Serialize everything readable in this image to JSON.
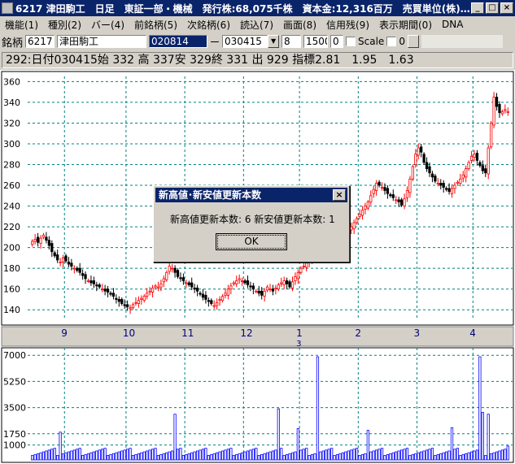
{
  "window": {
    "title": "6217 津田駒工　日足　東証一部・機械　発行株:68,075千株　資本金:12,316百万　売買単位(株)…"
  },
  "menu": [
    "機能(1)",
    "種別(2)",
    "バー(4)",
    "前銘柄(5)",
    "次銘柄(6)",
    "読込(7)",
    "画面(8)",
    "信用残(9)",
    "表示期間(0)",
    "DNA"
  ],
  "toolbar": {
    "label": "銘柄",
    "code": "6217",
    "name": "津田駒工",
    "date_from": "020814",
    "separator": "ー",
    "date_to": "030415",
    "n1": "8",
    "n2": "1500",
    "n3": "0",
    "scale_label": "Scale",
    "n4": "0"
  },
  "info_line": "292:日付030415始 332 高 337安 329終 331 出 929 指標2.81　1.95　1.63",
  "dialog": {
    "title": "新高値･新安値更新本数",
    "message": "新高値更新本数: 6  新安値更新本数: 1",
    "ok_label": "OK",
    "close": "×"
  },
  "colors": {
    "up": "#ff0000",
    "down": "#000000",
    "grid": "#008080",
    "volume": "#0000ff"
  },
  "chart_data": {
    "type": "candlestick",
    "price_axis": {
      "ticks": [
        140,
        160,
        180,
        200,
        220,
        240,
        260,
        280,
        300,
        320,
        340,
        360
      ],
      "ylim": [
        130,
        365
      ]
    },
    "month_labels": [
      "9",
      "10",
      "11",
      "12",
      "1",
      "2",
      "3",
      "4"
    ],
    "year_label": "3",
    "volume_axis": {
      "ticks": [
        "1000",
        "1750",
        "3500",
        "5250",
        "7000"
      ],
      "max": 7500
    },
    "last_bar": {
      "date": "030415",
      "open": 332,
      "high": 337,
      "low": 329,
      "close": 331,
      "volume": 929
    },
    "sample_closes": [
      206,
      208,
      205,
      209,
      212,
      207,
      202,
      196,
      192,
      188,
      186,
      190,
      187,
      184,
      182,
      180,
      178,
      176,
      173,
      170,
      168,
      166,
      165,
      163,
      162,
      160,
      158,
      157,
      155,
      153,
      150,
      148,
      146,
      144,
      143,
      142,
      145,
      147,
      149,
      151,
      153,
      156,
      158,
      161,
      163,
      162,
      165,
      170,
      176,
      182,
      180,
      176,
      172,
      170,
      168,
      166,
      164,
      162,
      160,
      158,
      155,
      152,
      150,
      148,
      146,
      144,
      147,
      150,
      153,
      156,
      160,
      163,
      166,
      168,
      170,
      168,
      166,
      164,
      162,
      160,
      158,
      156,
      154,
      158,
      162,
      160,
      158,
      161,
      164,
      166,
      168,
      165,
      162,
      167,
      172,
      176,
      180,
      182,
      185,
      188,
      191,
      194,
      196,
      198,
      200,
      202,
      204,
      206,
      205,
      204,
      206,
      209,
      212,
      216,
      220,
      224,
      228,
      232,
      236,
      240,
      244,
      250,
      256,
      262,
      260,
      258,
      255,
      252,
      250,
      248,
      246,
      244,
      241,
      247,
      255,
      266,
      278,
      290,
      296,
      292,
      282,
      276,
      272,
      268,
      264,
      262,
      260,
      258,
      256,
      254,
      257,
      260,
      263,
      266,
      270,
      276,
      282,
      288,
      290,
      284,
      279,
      274,
      272,
      296,
      320,
      345,
      336,
      330,
      331,
      333,
      331
    ]
  }
}
